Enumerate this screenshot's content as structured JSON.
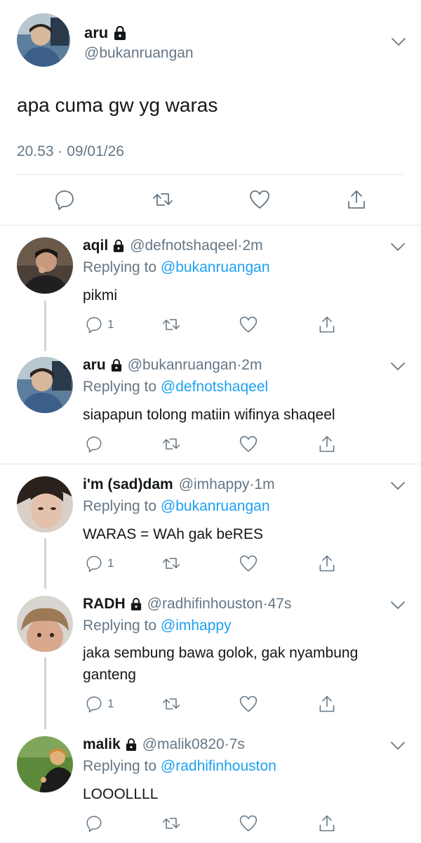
{
  "main_tweet": {
    "name": "aru",
    "handle": "@bukanruangan",
    "text": "apa cuma gw yg waras",
    "timestamp": "20.53 · 09/01/26",
    "actions": [
      "reply-icon",
      "retweet-icon",
      "like-icon",
      "share-icon"
    ]
  },
  "replies": [
    {
      "name": "aqil",
      "handle": "@defnotshaqeel",
      "dot": "·",
      "time": "2m",
      "replying_label": "Replying to",
      "replying_to": "@bukanruangan",
      "text": "pikmi",
      "reply_count": "1",
      "locked": true
    },
    {
      "name": "aru",
      "handle": "@bukanruangan",
      "dot": "·",
      "time": "2m",
      "replying_label": "Replying to",
      "replying_to": "@defnotshaqeel",
      "text": "siapapun tolong matiin wifinya shaqeel",
      "reply_count": "",
      "locked": true
    },
    {
      "name": "i'm (sad)dam",
      "handle": "@imhappy",
      "dot": "·",
      "time": "1m",
      "replying_label": "Replying to",
      "replying_to": "@bukanruangan",
      "text": "WARAS = WAh gak beRES",
      "reply_count": "1",
      "locked": false
    },
    {
      "name": "RADH",
      "handle": "@radhifinhouston",
      "dot": "·",
      "time": "47s",
      "replying_label": "Replying to",
      "replying_to": "@imhappy",
      "text": "jaka sembung bawa golok, gak nyambung ganteng",
      "reply_count": "1",
      "locked": true
    },
    {
      "name": "malik",
      "handle": "@malik0820",
      "dot": "·",
      "time": "7s",
      "replying_label": "Replying to",
      "replying_to": "@radhifinhouston",
      "text": "LOOOLLLL",
      "reply_count": "",
      "locked": true
    }
  ],
  "colors": {
    "link": "#1da1f2",
    "secondary": "#657786",
    "divider": "#e1e8ed",
    "thread_line": "#ccd6dd"
  }
}
